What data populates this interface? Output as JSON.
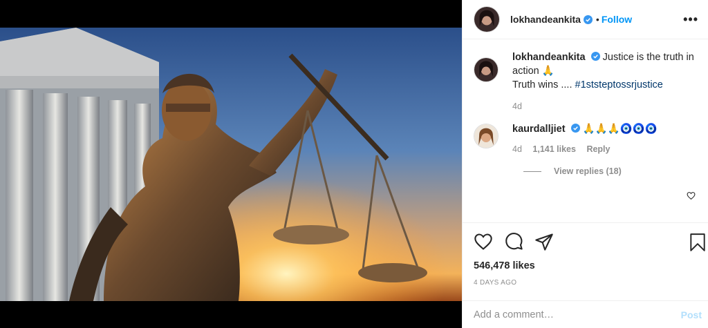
{
  "post": {
    "username": "lokhandeankita",
    "follow_label": "Follow",
    "dot": "•",
    "more_label": "•••",
    "photo_icon": "lady-justice-photo"
  },
  "caption": {
    "username": "lokhandeankita",
    "text_1": "Justice is the truth in action 🙏",
    "text_2": "Truth wins .... ",
    "hashtag": "#1ststeptossrjustice",
    "time": "4d"
  },
  "comment": {
    "username": "kaurdalljiet",
    "text": "🙏🙏🙏🧿🧿🧿",
    "time": "4d",
    "likes": "1,141 likes",
    "reply_label": "Reply",
    "view_replies": "View replies (18)"
  },
  "actions": {
    "likes": "546,478 likes",
    "date": "4 DAYS AGO"
  },
  "add_comment": {
    "placeholder": "Add a comment…",
    "post_label": "Post"
  },
  "colors": {
    "accent": "#0095f6",
    "hashtag": "#00376b",
    "muted": "#8e8e8e",
    "post_disabled": "#b2dffc"
  }
}
